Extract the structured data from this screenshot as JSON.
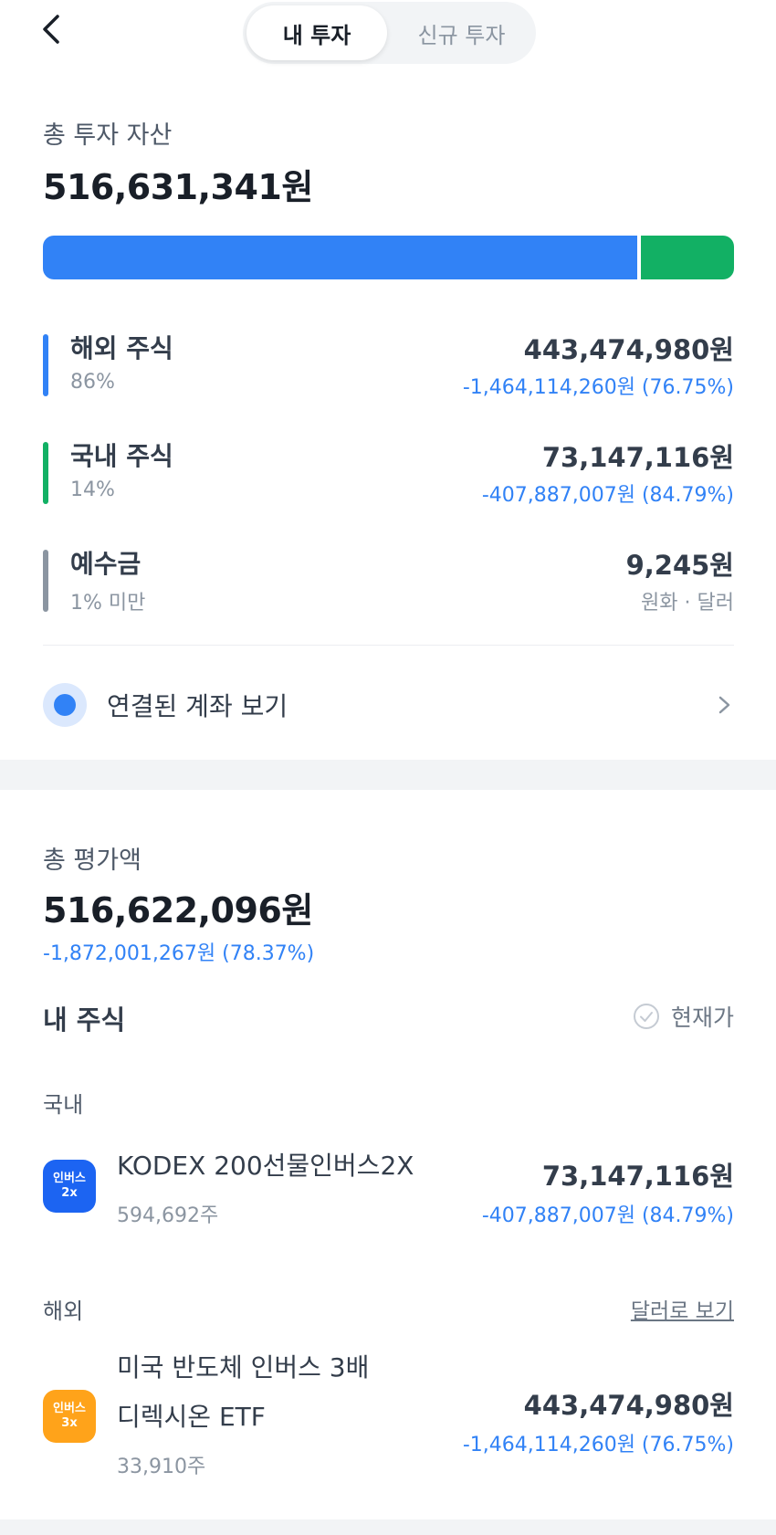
{
  "header": {
    "tabs": [
      {
        "label": "내 투자",
        "active": true
      },
      {
        "label": "신규 투자",
        "active": false
      }
    ]
  },
  "total_assets": {
    "label": "총 투자 자산",
    "amount": "516,631,341원",
    "bar": {
      "overseas_fraction": 0.86,
      "domestic_fraction": 0.14,
      "colors": {
        "overseas": "#3182f6",
        "domestic": "#12b064"
      }
    },
    "categories": [
      {
        "name": "해외 주식",
        "percent": "86%",
        "amount": "443,474,980원",
        "change": "-1,464,114,260원 (76.75%)",
        "color": "#3182f6"
      },
      {
        "name": "국내 주식",
        "percent": "14%",
        "amount": "73,147,116원",
        "change": "-407,887,007원 (84.79%)",
        "color": "#12b064"
      },
      {
        "name": "예수금",
        "percent": "1% 미만",
        "amount": "9,245원",
        "change": "원화 · 달러",
        "color": "#8b95a1"
      }
    ],
    "linked_accounts_label": "연결된 계좌 보기"
  },
  "evaluation": {
    "label": "총 평가액",
    "amount": "516,622,096원",
    "change": "-1,872,001,267원 (78.37%)"
  },
  "my_stocks": {
    "title": "내 주식",
    "current_price_label": "현재가",
    "domestic": {
      "label": "국내",
      "items": [
        {
          "icon_line1": "인버스",
          "icon_line2": "2x",
          "name": "KODEX 200선물인버스2X",
          "qty": "594,692주",
          "amount": "73,147,116원",
          "change": "-407,887,007원 (84.79%)"
        }
      ]
    },
    "overseas": {
      "label": "해외",
      "dollar_view_label": "달러로 보기",
      "items": [
        {
          "icon_line1": "인버스",
          "icon_line2": "3x",
          "name_line1": "미국 반도체 인버스 3배",
          "name_line2": "디렉시온 ETF",
          "qty": "33,910주",
          "amount": "443,474,980원",
          "change": "-1,464,114,260원 (76.75%)"
        }
      ]
    }
  },
  "colors": {
    "accent": "#3182f6",
    "positive_green": "#12b064",
    "text": "#191f28",
    "muted": "#8b95a1"
  }
}
